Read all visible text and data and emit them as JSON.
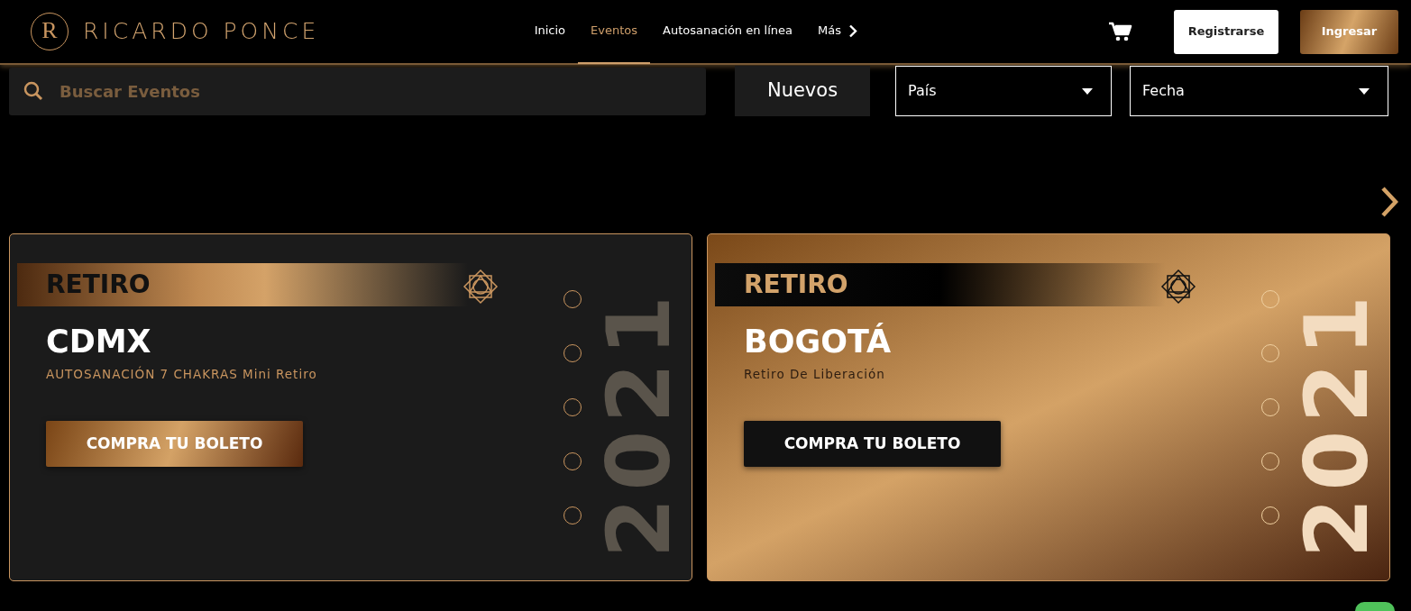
{
  "brand": {
    "monogram": "R",
    "name": "RICARDO PONCE"
  },
  "nav": [
    {
      "label": "Inicio",
      "selected": false
    },
    {
      "label": "Eventos",
      "selected": true
    },
    {
      "label": "Autosanación en línea",
      "selected": false
    },
    {
      "label": "Más",
      "selected": false,
      "kind": "more"
    }
  ],
  "actions": {
    "register": "Registrarse",
    "login": "Ingresar"
  },
  "filters": {
    "search": {
      "placeholder": "Buscar Eventos"
    },
    "sort": "Nuevos",
    "country": "País",
    "date": "Fecha"
  },
  "events": [
    {
      "kind": "dark",
      "tag": "RETIRO",
      "city": "CDMX",
      "subtitle": "AUTOSANACIÓN 7 CHAKRAS Mini Retiro",
      "button": "COMPRA TU BOLETO",
      "year": "2021"
    },
    {
      "kind": "gold",
      "tag": "RETIRO",
      "city": "BOGOTÁ",
      "subtitle": "Retiro De Liberación",
      "button": "COMPRA TU BOLETO",
      "year": "2021"
    }
  ]
}
